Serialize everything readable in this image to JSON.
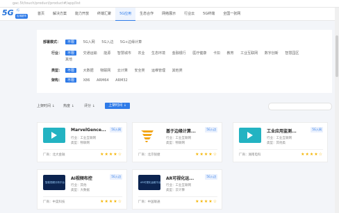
{
  "address_bar": "gac.5t/touch/product/product#/app/list",
  "header": {
    "logo_big": "5G",
    "logo_sup": "行",
    "logo_badge": "应用超市",
    "nav": [
      "首页",
      "解决方案",
      "能力开放",
      "终端汇聚",
      "5G应用",
      "生态合作",
      "网络展示",
      "行业云",
      "5G终端",
      "全国一张网"
    ],
    "active_index": 4
  },
  "filters": {
    "scene": {
      "label": "部署模式：",
      "options": [
        "不限",
        "5G入网",
        "5G入边",
        "5G+边缘计算"
      ]
    },
    "industry": {
      "label": "行业：",
      "options": [
        "不限",
        "交通运输",
        "能源",
        "智慧城市",
        "农业",
        "生态环境",
        "金融银行",
        "医疗健康",
        "卡扣",
        "教育",
        "工业互联网",
        "数字创新",
        "智慧园区",
        "其他"
      ]
    },
    "type": {
      "label": "类型：",
      "options": [
        "不限",
        "大数据",
        "物联网",
        "云计算",
        "安全类",
        "运维管理",
        "其他类"
      ]
    },
    "arch": {
      "label": "架构：",
      "options": [
        "不限",
        "X86",
        "ARM64",
        "ARM32"
      ]
    }
  },
  "sort": {
    "newest": "上架时间 ↓",
    "hot": "热度 ↓",
    "rating": "评分 ↓",
    "apply": "上架时间 ↓"
  },
  "cards": [
    {
      "title": "MarvelGence...",
      "tag": "5G入网",
      "l1": "行业：工业互联网",
      "l2": "类型：物联网",
      "vendor": "厂商：北大金融",
      "stars": "★★★★☆",
      "thumb": "play"
    },
    {
      "title": "基于边缘计算...",
      "tag": "5G入边",
      "l1": "行业：工业互联网",
      "l2": "类型：物联网",
      "vendor": "厂商：北京锐捷",
      "stars": "★★★★☆",
      "thumb": "sf"
    },
    {
      "title": "工业应用监测...",
      "tag": "5G入网",
      "l1": "行业：工业互联网",
      "l2": "类型：其他类",
      "vendor": "厂商：湖南电科",
      "stars": "★★★★☆",
      "thumb": "play"
    },
    {
      "title": "AI视频布控",
      "tag": "5G入边",
      "l1": "行业：其他",
      "l2": "类型：大数据",
      "vendor": "厂商：中昊科技",
      "stars": "★★★★☆",
      "thumb": "dark",
      "thumb_text": "智能视频分析平台"
    },
    {
      "title": "AR可视化运...",
      "tag": "5G入边",
      "l1": "行业：工业互联网",
      "l2": "类型：云计算",
      "vendor": "厂商：中国联通",
      "stars": "★★★★☆",
      "thumb": "dark",
      "thumb_text": "AR可视化运维平台"
    }
  ],
  "colors": {
    "accent": "#2f7be8",
    "star": "#f5b400",
    "teal": "#23b3c2"
  }
}
